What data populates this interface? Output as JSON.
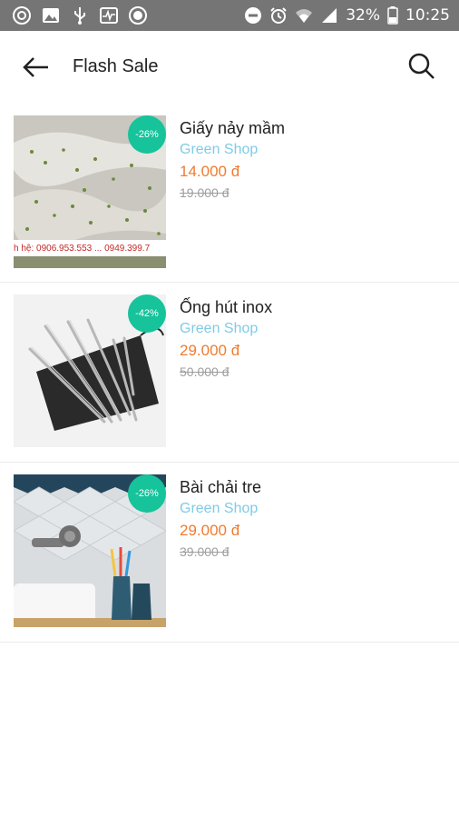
{
  "status_bar": {
    "battery_text": "32%",
    "time": "10:25"
  },
  "app_bar": {
    "title": "Flash Sale"
  },
  "products": [
    {
      "discount": "-26%",
      "name": "Giấy nảy mầm",
      "shop": "Green Shop",
      "price": "14.000 đ",
      "old_price": "19.000 đ",
      "image_caption": "h hệ: 0906.953.553 ... 0949.399.7"
    },
    {
      "discount": "-42%",
      "name": "Ống hút inox",
      "shop": "Green Shop",
      "price": "29.000 đ",
      "old_price": "50.000 đ"
    },
    {
      "discount": "-26%",
      "name": "Bài chải tre",
      "shop": "Green Shop",
      "price": "29.000 đ",
      "old_price": "39.000 đ"
    }
  ],
  "colors": {
    "status_bar_bg": "#757575",
    "discount_badge": "#16c39b",
    "shop_name": "#7fcbe7",
    "price": "#f07b2f",
    "old_price": "#9e9e9e"
  }
}
